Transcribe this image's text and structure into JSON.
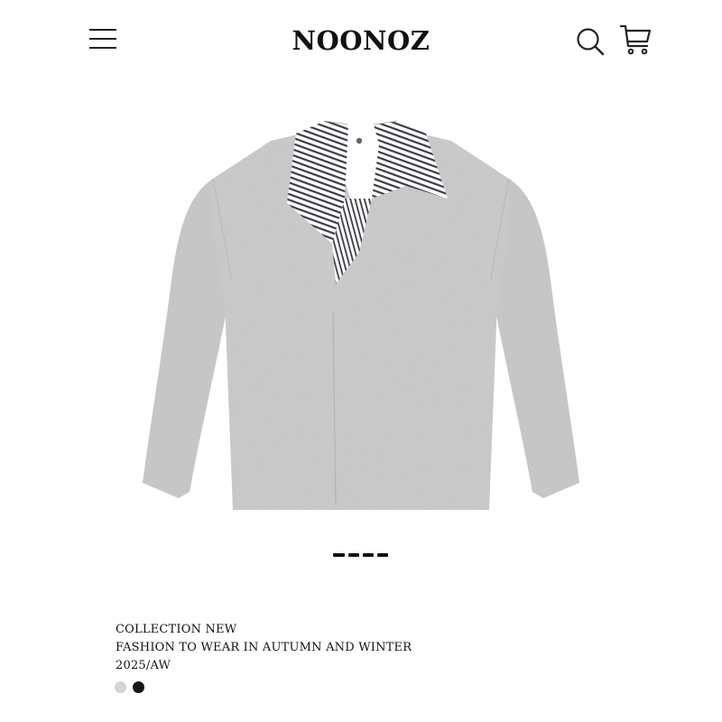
{
  "header": {
    "brand": "NOONOZ",
    "icons": {
      "menu": "menu-icon",
      "search": "search-icon",
      "cart": "cart-icon"
    }
  },
  "product": {
    "image": "grey-polo-collar-sweatshirt",
    "colors": {
      "body": "#c9c9c9",
      "stripe": "#3a3d45"
    }
  },
  "carousel": {
    "slide_count": 4,
    "active_index": 0
  },
  "info": {
    "line1": "COLLECTION NEW",
    "line2": "FASHION TO WEAR IN AUTUMN AND WINTER",
    "line3": "2025/AW"
  },
  "swatches": [
    {
      "name": "grey",
      "color": "#d3d4d7"
    },
    {
      "name": "black",
      "color": "#151515"
    }
  ]
}
